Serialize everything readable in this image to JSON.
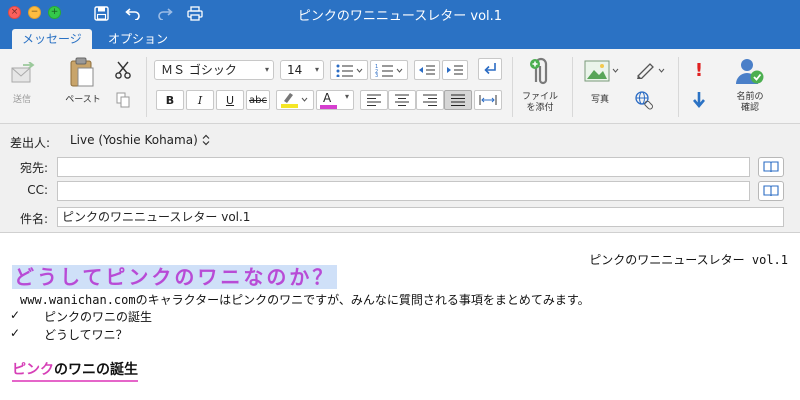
{
  "window": {
    "title": "ピンクのワニニュースレター vol.1"
  },
  "tabs": [
    {
      "label": "メッセージ",
      "active": true
    },
    {
      "label": "オプション",
      "active": false
    }
  ],
  "ribbon": {
    "send_label": "送信",
    "paste_label": "ペースト",
    "font_name": "ＭＳ ゴシック",
    "font_size": "14",
    "bold": "B",
    "italic": "I",
    "underline": "U",
    "strike": "abc",
    "font_color_letter": "A",
    "attach_label_1": "ファイル",
    "attach_label_2": "を添付",
    "photo_label": "写真",
    "check_names_label_1": "名前の",
    "check_names_label_2": "確認",
    "colors": {
      "highlight": "#f5e626",
      "font_color": "#d63fcf",
      "accent": "#2b72c4"
    }
  },
  "header": {
    "from_label": "差出人:",
    "from_value": "Live (Yoshie Kohama)",
    "to_label": "宛先:",
    "to_value": "",
    "cc_label": "CC:",
    "cc_value": "",
    "subject_label": "件名:",
    "subject_value": "ピンクのワニニュースレター vol.1"
  },
  "body": {
    "newsletter_title": "ピンクのワニニュースレター vol.1",
    "headline": "どうしてピンクのワニなのか？",
    "intro_url": "www.wanichan.com",
    "intro_text": "のキャラクターはピンクのワニですが、みんなに質問される事項をまとめてみます。",
    "checklist": [
      "ピンクのワニの誕生",
      "どうしてワニ？"
    ],
    "check_mark": "✓",
    "section_pink": "ピンク",
    "section_rest": "のワニの誕生"
  }
}
